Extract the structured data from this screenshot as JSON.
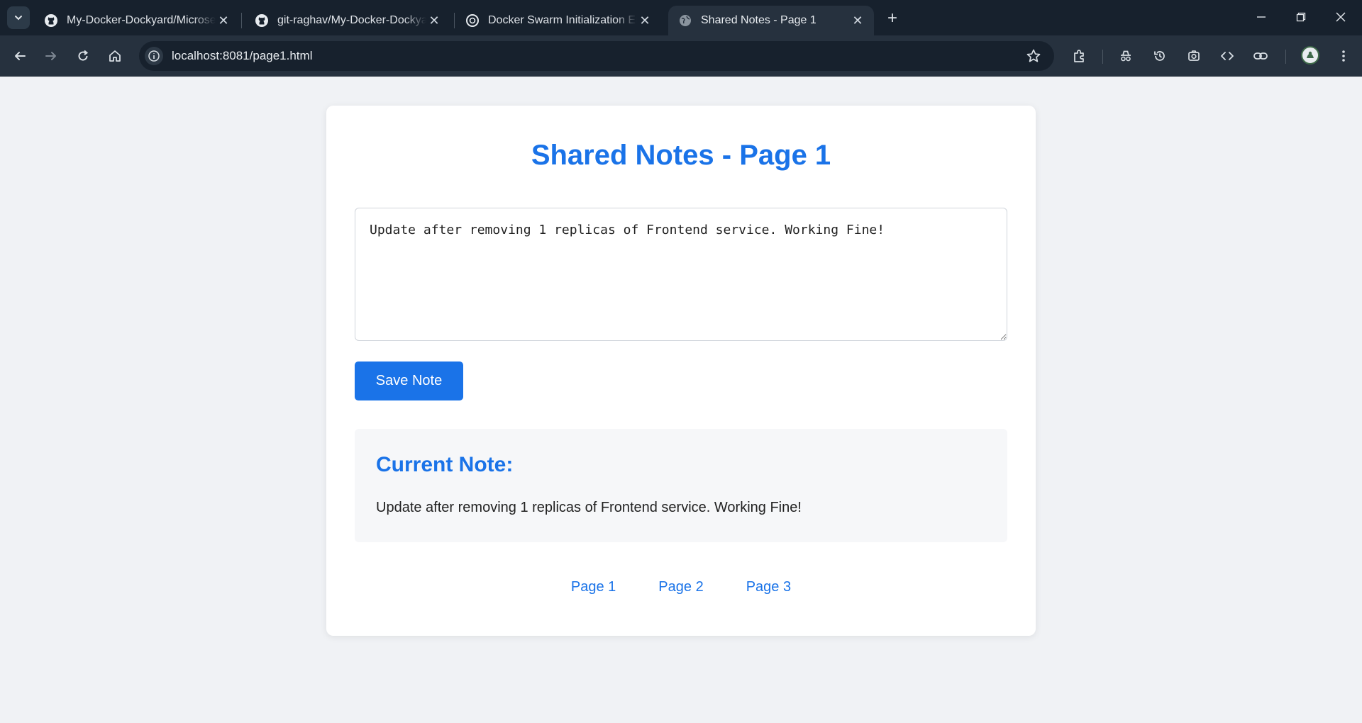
{
  "browser": {
    "tabs": [
      {
        "title": "My-Docker-Dockyard/Microservices",
        "icon": "github-icon",
        "active": false
      },
      {
        "title": "git-raghav/My-Docker-Dockyard",
        "icon": "github-icon",
        "active": false
      },
      {
        "title": "Docker Swarm Initialization Error",
        "icon": "chatgpt-icon",
        "active": false
      },
      {
        "title": "Shared Notes - Page 1",
        "icon": "globe-icon",
        "active": true
      }
    ],
    "address": "localhost:8081/page1.html",
    "colors": {
      "frame": "#17212d",
      "toolbar": "#26313e"
    }
  },
  "page": {
    "title": "Shared Notes - Page 1",
    "textarea_value": "Update after removing 1 replicas of Frontend service. Working Fine!",
    "save_label": "Save Note",
    "current_heading": "Current Note:",
    "current_note": "Update after removing 1 replicas of Frontend service. Working Fine!",
    "nav": [
      "Page 1",
      "Page 2",
      "Page 3"
    ],
    "colors": {
      "accent": "#1a73e8",
      "background": "#f0f2f5"
    }
  }
}
